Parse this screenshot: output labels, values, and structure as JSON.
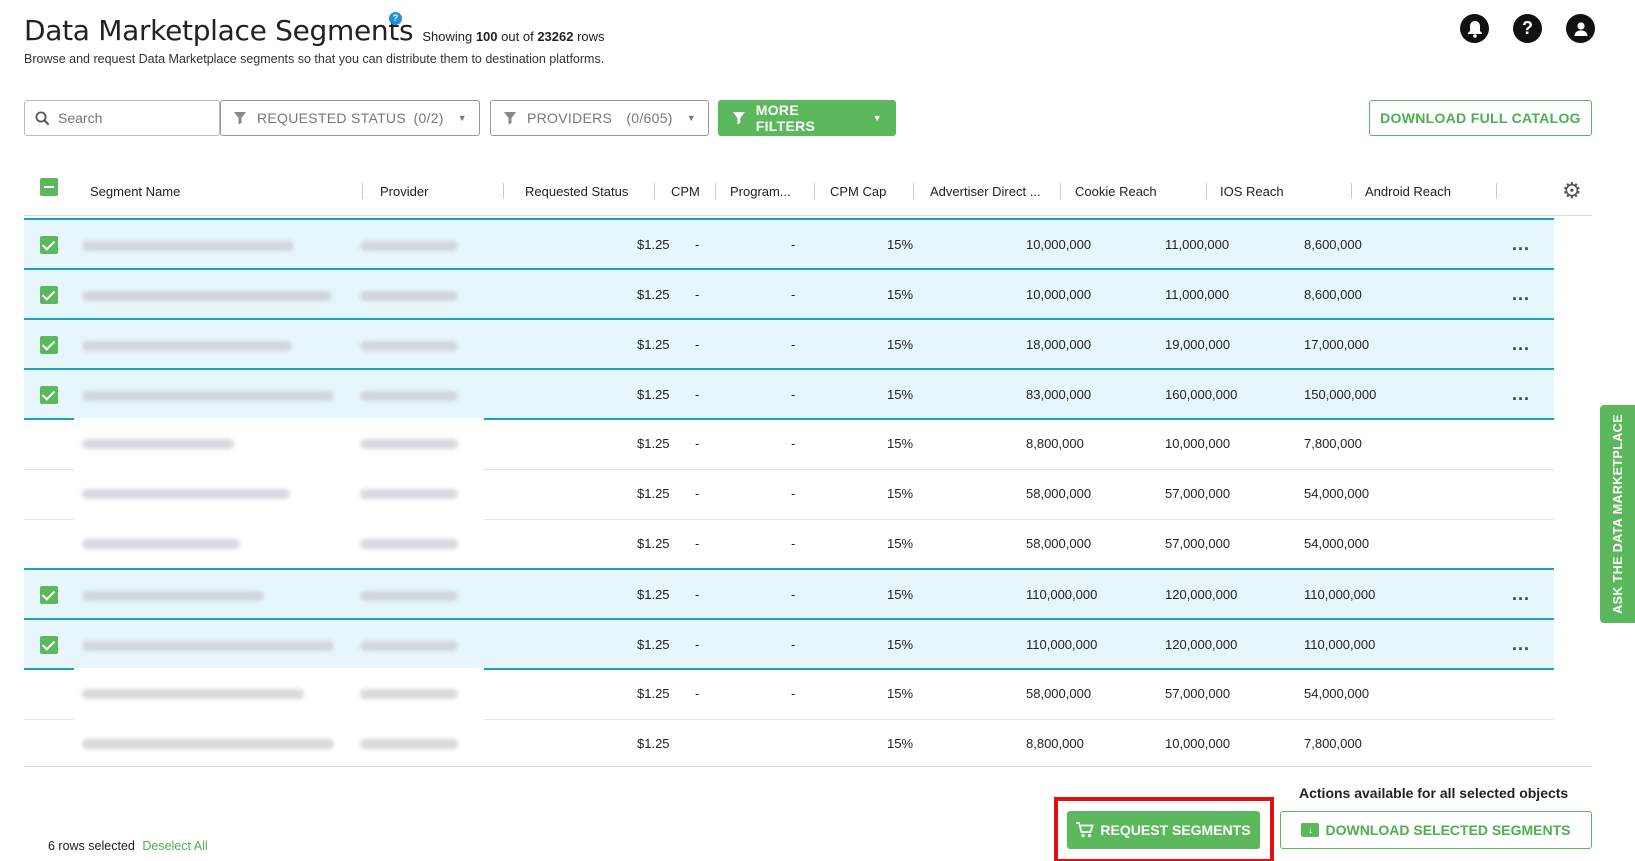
{
  "header": {
    "title": "Data Marketplace Segments",
    "help_icon": "question-icon",
    "showing_prefix": "Showing",
    "showing_count": "100",
    "showing_mid": "out of",
    "showing_total": "23262",
    "showing_suffix": "rows",
    "subtitle": "Browse and request Data Marketplace segments so that you can distribute them to destination platforms.",
    "icons": [
      "bell-icon",
      "help-icon",
      "user-icon"
    ]
  },
  "toolbar": {
    "search_placeholder": "Search",
    "requested_status_label": "REQUESTED STATUS",
    "requested_status_count": "(0/2)",
    "providers_label": "PROVIDERS",
    "providers_count": "(0/605)",
    "more_filters_label": "MORE FILTERS",
    "download_catalog_label": "DOWNLOAD FULL CATALOG"
  },
  "table": {
    "columns": [
      "Segment Name",
      "Provider",
      "Requested Status",
      "CPM",
      "Program...",
      "CPM Cap",
      "Advertiser Direct ...",
      "Cookie Reach",
      "IOS Reach",
      "Android Reach"
    ],
    "rows": [
      {
        "selected": true,
        "cpm": "$1.25",
        "program": "-",
        "cpm_cap": "-",
        "adv": "15%",
        "cookie": "10,000,000",
        "ios": "11,000,000",
        "android": "8,600,000",
        "menu": "..."
      },
      {
        "selected": true,
        "cpm": "$1.25",
        "program": "-",
        "cpm_cap": "-",
        "adv": "15%",
        "cookie": "10,000,000",
        "ios": "11,000,000",
        "android": "8,600,000",
        "menu": "..."
      },
      {
        "selected": true,
        "cpm": "$1.25",
        "program": "-",
        "cpm_cap": "-",
        "adv": "15%",
        "cookie": "18,000,000",
        "ios": "19,000,000",
        "android": "17,000,000",
        "menu": "..."
      },
      {
        "selected": true,
        "cpm": "$1.25",
        "program": "-",
        "cpm_cap": "-",
        "adv": "15%",
        "cookie": "83,000,000",
        "ios": "160,000,000",
        "android": "150,000,000",
        "menu": "..."
      },
      {
        "selected": false,
        "cpm": "$1.25",
        "program": "-",
        "cpm_cap": "-",
        "adv": "15%",
        "cookie": "8,800,000",
        "ios": "10,000,000",
        "android": "7,800,000",
        "menu": ""
      },
      {
        "selected": false,
        "cpm": "$1.25",
        "program": "-",
        "cpm_cap": "-",
        "adv": "15%",
        "cookie": "58,000,000",
        "ios": "57,000,000",
        "android": "54,000,000",
        "menu": ""
      },
      {
        "selected": false,
        "cpm": "$1.25",
        "program": "-",
        "cpm_cap": "-",
        "adv": "15%",
        "cookie": "58,000,000",
        "ios": "57,000,000",
        "android": "54,000,000",
        "menu": ""
      },
      {
        "selected": true,
        "cpm": "$1.25",
        "program": "-",
        "cpm_cap": "-",
        "adv": "15%",
        "cookie": "110,000,000",
        "ios": "120,000,000",
        "android": "110,000,000",
        "menu": "..."
      },
      {
        "selected": true,
        "cpm": "$1.25",
        "program": "-",
        "cpm_cap": "-",
        "adv": "15%",
        "cookie": "110,000,000",
        "ios": "120,000,000",
        "android": "110,000,000",
        "menu": "..."
      },
      {
        "selected": false,
        "cpm": "$1.25",
        "program": "-",
        "cpm_cap": "-",
        "adv": "15%",
        "cookie": "58,000,000",
        "ios": "57,000,000",
        "android": "54,000,000",
        "menu": ""
      },
      {
        "selected": false,
        "cpm": "$1.25",
        "program": "",
        "cpm_cap": "",
        "adv": "15%",
        "cookie": "8,800,000",
        "ios": "10,000,000",
        "android": "7,800,000",
        "menu": ""
      }
    ]
  },
  "footer": {
    "rows_selected": "6 rows selected",
    "deselect_all": "Deselect All",
    "actions_label": "Actions available for all selected objects",
    "request_segments": "REQUEST SEGMENTS",
    "download_selected": "DOWNLOAD SELECTED SEGMENTS"
  },
  "side_tab": {
    "label": "ASK THE DATA MARKETPLACE"
  },
  "colors": {
    "accent_green": "#5cb85c",
    "selected_row_bg": "#e7f6fb",
    "selected_row_border": "#1aa2c6",
    "highlight_red": "#e01010"
  }
}
